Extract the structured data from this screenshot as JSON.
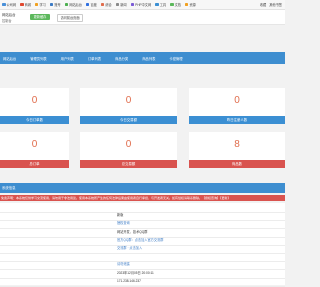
{
  "bookmarks": {
    "items": [
      {
        "label": "公司网",
        "color": "#4a90d9"
      },
      {
        "label": "商城",
        "color": "#e0482f"
      },
      {
        "label": "学习",
        "color": "#f0a020"
      },
      {
        "label": "账号",
        "color": "#3b7ac4"
      },
      {
        "label": "网站后台",
        "color": "#4caf50"
      },
      {
        "label": "百度",
        "color": "#2f6fe0"
      },
      {
        "label": "综合",
        "color": "#e06c4c"
      },
      {
        "label": "新闻",
        "color": "#888888"
      },
      {
        "label": "PHP中文网",
        "color": "#7b5bd6"
      },
      {
        "label": "工具",
        "color": "#3b8fd3"
      },
      {
        "label": "文档",
        "color": "#5cb85c"
      },
      {
        "label": "资源",
        "color": "#f0a020"
      }
    ],
    "right": [
      "收藏",
      "其他书签"
    ]
  },
  "header": {
    "title": "网站后台",
    "title2": "控制台",
    "green_button": "更新缓存",
    "white_button": "访问前台页面"
  },
  "nav": {
    "items": [
      "网站后台",
      "管理员列表",
      "用户列表",
      "订单列表",
      "商品分类",
      "商品列表",
      "卡密管理"
    ]
  },
  "stats": {
    "top": [
      {
        "value": "0",
        "label": "今日订单数"
      },
      {
        "value": "0",
        "label": "今日交易额"
      },
      {
        "value": "0",
        "label": "昨日注册人数"
      }
    ],
    "bottom": [
      {
        "value": "0",
        "label": "总订单"
      },
      {
        "value": "0",
        "label": "总交易额"
      },
      {
        "value": "8",
        "label": "商品数"
      }
    ]
  },
  "panel": {
    "title": "系统信息",
    "notice": "免责声明：本系统仅供学习交流使用，请勿用于非法用途。使用本系统所产生的任何法律后果由使用者自行承担，与开发者无关。如有侵权请联系删除。【授权查询】【更新】"
  },
  "info_rows": [
    {
      "key": "",
      "value": "",
      "link": false
    },
    {
      "key": "",
      "value": "新版",
      "link": false
    },
    {
      "key": "",
      "value": "授权查询",
      "link": true
    },
    {
      "key": "",
      "value": "网站开发、技术QQ群",
      "link": false
    },
    {
      "key": "",
      "value": "官方QQ群：点击加入官方交流群",
      "link": true
    },
    {
      "key": "",
      "value": "交流群 · 点击加入",
      "link": true
    },
    {
      "key": "",
      "value": "",
      "link": false
    },
    {
      "key": "",
      "value": "请勿泄露",
      "link": true
    },
    {
      "key": "",
      "value": "2023年12月05日 20:00:11",
      "link": false
    },
    {
      "key": "",
      "value": "171.238.146.237",
      "link": false
    }
  ]
}
